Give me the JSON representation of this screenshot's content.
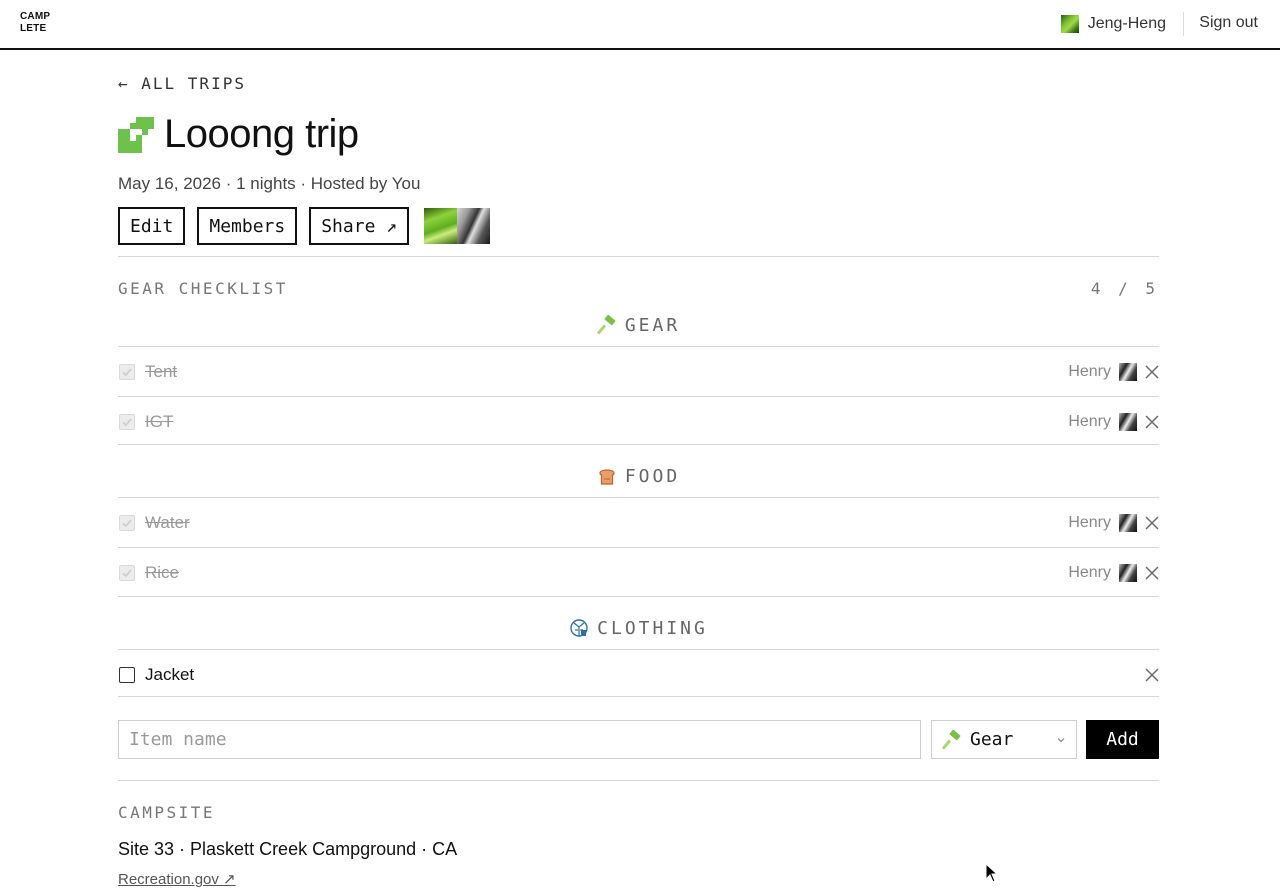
{
  "header": {
    "logo_line1": "CAMP",
    "logo_line2": "LETE",
    "user_name": "Jeng-Heng",
    "sign_out_label": "Sign out"
  },
  "trip": {
    "back_label": "← ALL TRIPS",
    "title": "Looong trip",
    "meta": "May 16, 2026 · 1 nights · Hosted by You",
    "actions": {
      "edit_label": "Edit",
      "members_label": "Members",
      "share_label": "Share ↗"
    }
  },
  "checklist": {
    "section_label": "GEAR CHECKLIST",
    "progress": "4 / 5",
    "categories": [
      {
        "label": "GEAR",
        "icon": "hammer-icon",
        "items": [
          {
            "name": "Tent",
            "checked": true,
            "assignee": "Henry"
          },
          {
            "name": "IGT",
            "checked": true,
            "assignee": "Henry"
          }
        ]
      },
      {
        "label": "FOOD",
        "icon": "bread-icon",
        "items": [
          {
            "name": "Water",
            "checked": true,
            "assignee": "Henry"
          },
          {
            "name": "Rice",
            "checked": true,
            "assignee": "Henry"
          }
        ]
      },
      {
        "label": "CLOTHING",
        "icon": "coat-icon",
        "items": [
          {
            "name": "Jacket",
            "checked": false,
            "assignee": ""
          }
        ]
      }
    ],
    "add_form": {
      "name_placeholder": "Item name",
      "name_value": "",
      "category_value": "Gear",
      "add_label": "Add"
    }
  },
  "campsite": {
    "section_label": "CAMPSITE",
    "site": "Site 33 · Plaskett Creek Campground · CA",
    "link_label": "Recreation.gov ↗"
  },
  "colors": {
    "accent_green": "#6cc24a",
    "text": "#111111",
    "muted": "#777777"
  }
}
